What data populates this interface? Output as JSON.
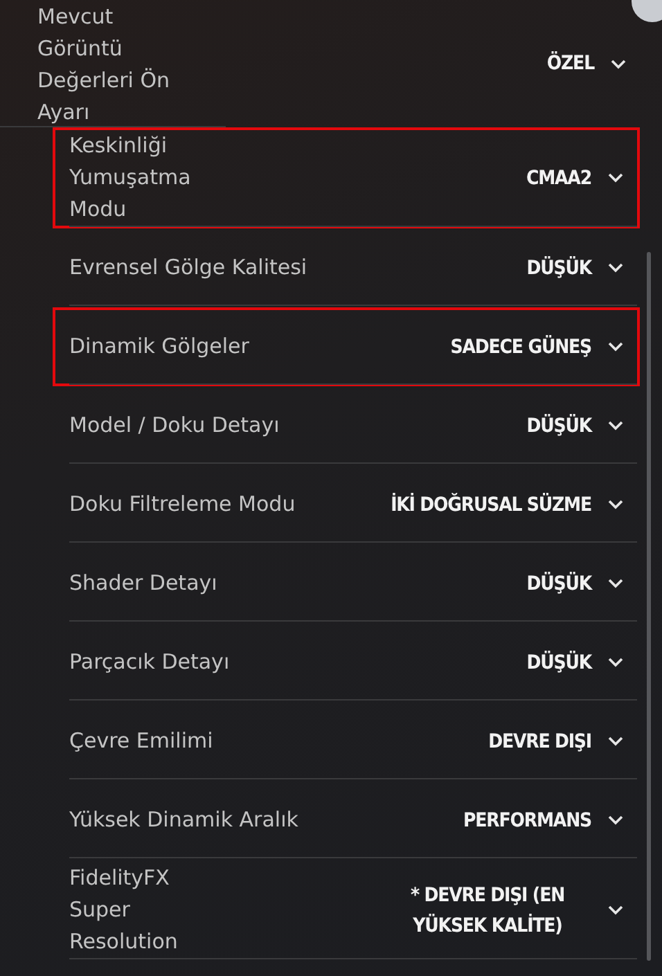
{
  "preset": {
    "label": "Mevcut Görüntü Değerleri Ön Ayarı",
    "value": "ÖZEL"
  },
  "settings": [
    {
      "label": "Keskinliği Yumuşatma Modu",
      "value": "CMAA2",
      "kind": "narrow",
      "highlighted": true
    },
    {
      "label": "Evrensel Gölge Kalitesi",
      "value": "DÜŞÜK",
      "kind": "wide",
      "highlighted": false
    },
    {
      "label": "Dinamik Gölgeler",
      "value": "SADECE GÜNEŞ",
      "kind": "wide",
      "highlighted": true
    },
    {
      "label": "Model / Doku Detayı",
      "value": "DÜŞÜK",
      "kind": "wide",
      "highlighted": false
    },
    {
      "label": "Doku Filtreleme Modu",
      "value": "İKİ DOĞRUSAL SÜZME",
      "kind": "wide",
      "highlighted": false
    },
    {
      "label": "Shader Detayı",
      "value": "DÜŞÜK",
      "kind": "wide",
      "highlighted": false
    },
    {
      "label": "Parçacık Detayı",
      "value": "DÜŞÜK",
      "kind": "wide",
      "highlighted": false
    },
    {
      "label": "Çevre Emilimi",
      "value": "DEVRE DIŞI",
      "kind": "wide",
      "highlighted": false
    },
    {
      "label": "Yüksek Dinamik Aralık",
      "value": "PERFORMANS",
      "kind": "wide",
      "highlighted": false
    },
    {
      "label": "FidelityFX Super Resolution",
      "value": "* DEVRE DIŞI (EN YÜKSEK KALİTE)",
      "kind": "narrow",
      "highlighted": false
    }
  ]
}
